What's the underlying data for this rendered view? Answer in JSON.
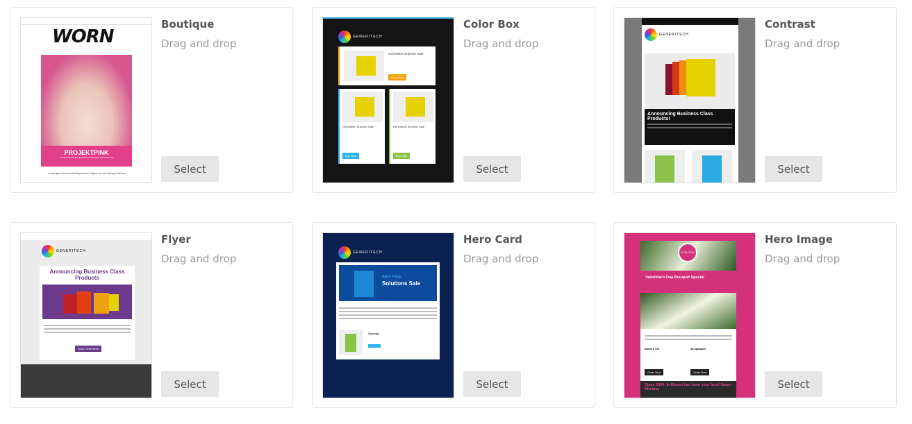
{
  "templates": [
    {
      "name": "Boutique",
      "type": "Drag and drop",
      "select_label": "Select",
      "thumb": {
        "logo": "WORN",
        "headline": "PROJEKTPINK",
        "tagline": "GEAR UP FOR SPRING WITH OUR NEW COLLECTION",
        "footer": "Lovely light colors and thrilling textures inspire our new Spring Collection",
        "accent": "#e0418a"
      }
    },
    {
      "name": "Color Box",
      "type": "Drag and drop",
      "select_label": "Select",
      "thumb": {
        "brand": "GENERITECH",
        "headline": "Generitech Summer Sale",
        "buttons": [
          "Shop Now",
          "Buy Now",
          "Buy Now"
        ],
        "accent": "#f0a30a"
      }
    },
    {
      "name": "Contrast",
      "type": "Drag and drop",
      "select_label": "Select",
      "thumb": {
        "brand": "GENERITECH",
        "headline": "Announcing Business Class Products!",
        "accent": "#111111"
      }
    },
    {
      "name": "Flyer",
      "type": "Drag and drop",
      "select_label": "Select",
      "thumb": {
        "brand": "GENERITECH",
        "headline": "Announcing Business Class Products",
        "button": "Shop Generitech",
        "accent": "#6b3a8c"
      }
    },
    {
      "name": "Hero Card",
      "type": "Drag and drop",
      "select_label": "Select",
      "thumb": {
        "brand": "GENERITECH",
        "kicker": "Black Friday",
        "headline": "Solutions Sale",
        "product": "Synergy",
        "accent": "#0b2150"
      }
    },
    {
      "name": "Hero Image",
      "type": "Drag and drop",
      "select_label": "Select",
      "thumb": {
        "badge": "IN BLOOM",
        "headline": "Valentine's Day Bouquet Special",
        "col1": "Album A Girl",
        "col2": "All Apologies",
        "button": "Order Now",
        "footer_headline": "Since 1994, In Bloom has been your local flower Nirvana.",
        "accent": "#d4317a"
      }
    }
  ]
}
